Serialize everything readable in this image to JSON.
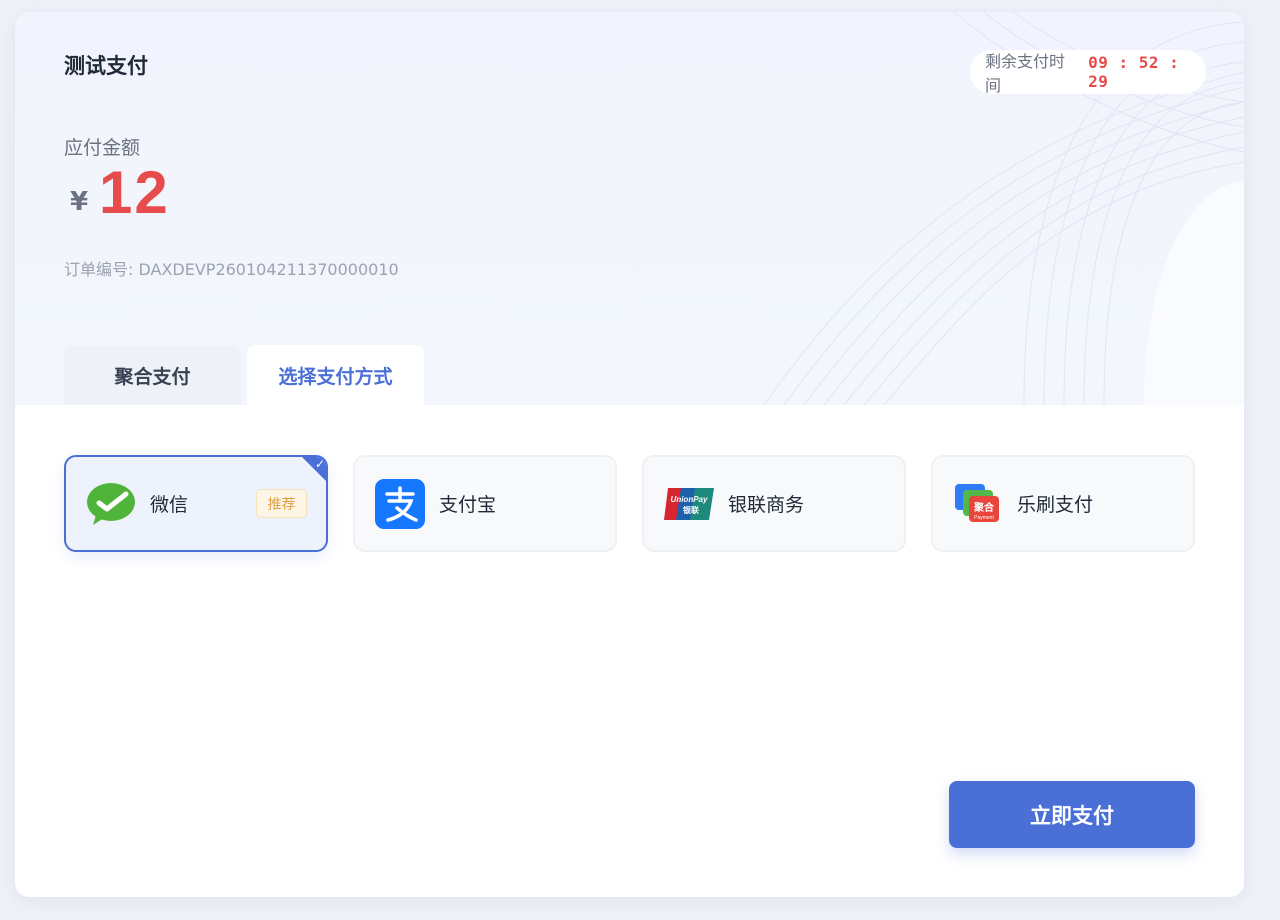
{
  "merchant": {
    "name": "测试支付"
  },
  "timer": {
    "label": "剩余支付时间",
    "value": "09 : 52 : 29"
  },
  "amount": {
    "label": "应付金额",
    "currency": "¥",
    "value": "12"
  },
  "order": {
    "label": "订单编号: DAXDEVP260104211370000010"
  },
  "tabs": [
    {
      "label": "聚合支付",
      "active": false
    },
    {
      "label": "选择支付方式",
      "active": true
    }
  ],
  "methods": [
    {
      "label": "微信",
      "icon": "wechat-icon",
      "selected": true,
      "badge": "推荐"
    },
    {
      "label": "支付宝",
      "icon": "alipay-icon",
      "selected": false
    },
    {
      "label": "银联商务",
      "icon": "unionpay-icon",
      "selected": false
    },
    {
      "label": "乐刷支付",
      "icon": "leshua-icon",
      "selected": false
    }
  ],
  "unionpay_logo_text": "UnionPay 银联",
  "leshua_logo_text": "聚合 Payment",
  "pay_button": {
    "label": "立即支付"
  },
  "colors": {
    "accent": "#4a70d8",
    "amount": "#e74c4c",
    "wechat": "#51b43a",
    "alipay": "#1677ff"
  }
}
